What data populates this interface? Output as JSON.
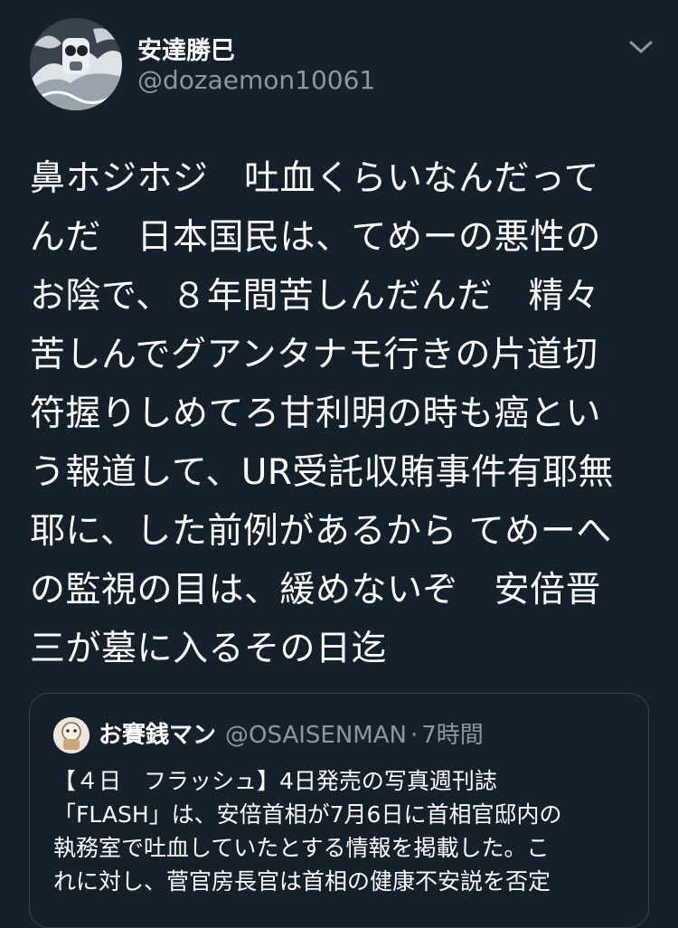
{
  "tweet": {
    "author": {
      "display_name": "安達勝巳",
      "handle": "@dozaemon10061"
    },
    "text": "鼻ホジホジ　吐血くらいなんだって\nんだ　日本国民は、てめーの悪性の\nお陰で、８年間苦しんだんだ　精々\n苦しんでグアンタナモ行きの片道切\n符握りしめてろ甘利明の時も癌とい\nう報道して、UR受託収賄事件有耶無\n耶に、した前例があるから てめーへ\nの監視の目は、緩めないぞ　安倍晋\n三が墓に入るその日迄"
  },
  "quoted_tweet": {
    "author": {
      "display_name": "お賽銭マン",
      "handle": "@OSAISENMAN"
    },
    "separator": "·",
    "time": "7時間",
    "text": "【４日　フラッシュ】4日発売の写真週刊誌\n「FLASH」は、安倍首相が7月6日に首相官邸内の\n執務室で吐血していたとする情報を掲載した。こ\nれに対し、菅官房長官は首相の健康不安説を否定"
  },
  "icons": {
    "menu": "chevron-down-icon"
  },
  "colors": {
    "background": "#15202b",
    "text": "#ffffff",
    "secondary": "#8899a6",
    "border": "#38444d"
  }
}
